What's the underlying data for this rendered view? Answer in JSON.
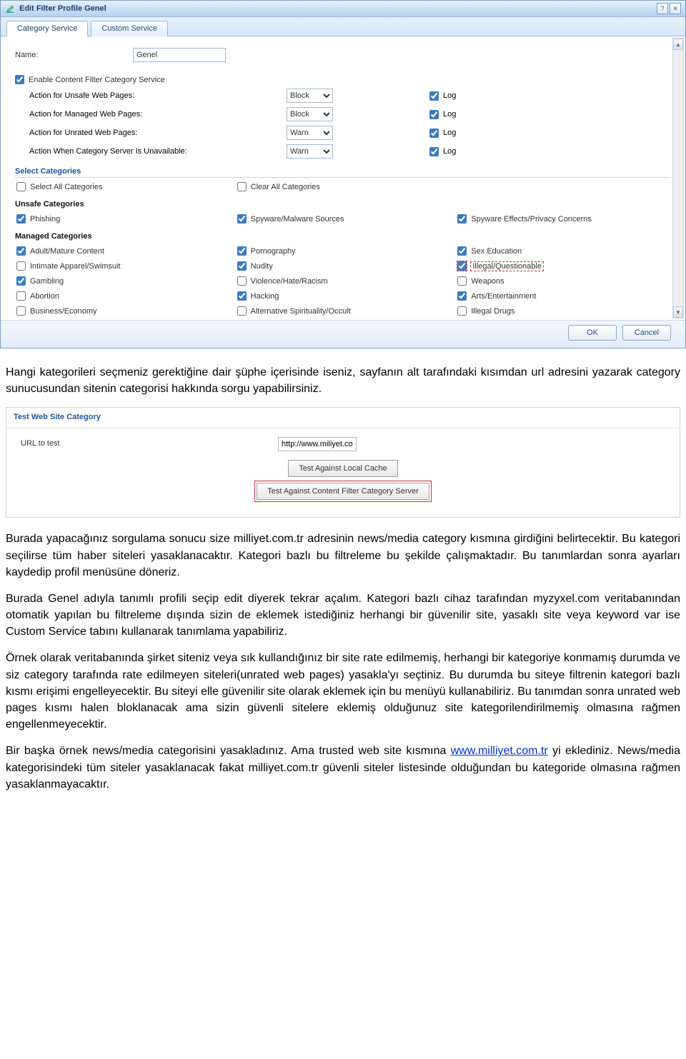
{
  "dialog": {
    "title": "Edit Filter Profile Genel",
    "tabs": {
      "category": "Category Service",
      "custom": "Custom Service"
    },
    "name_label": "Name:",
    "name_value": "Genel",
    "enable_label": "Enable Content Filter Category Service",
    "actions": {
      "unsafe": {
        "label": "Action for Unsafe Web Pages:",
        "value": "Block",
        "log": "Log"
      },
      "managed": {
        "label": "Action for Managed Web Pages:",
        "value": "Block",
        "log": "Log"
      },
      "unrated": {
        "label": "Action for Unrated Web Pages:",
        "value": "Warn",
        "log": "Log"
      },
      "unavailable": {
        "label": "Action When Category Server Is Unavailable:",
        "value": "Warn",
        "log": "Log"
      }
    },
    "select_categories_head": "Select Categories",
    "select_all": "Select All Categories",
    "clear_all": "Clear All Categories",
    "unsafe_head": "Unsafe Categories",
    "unsafe": {
      "phishing": "Phishing",
      "spyware_sources": "Spyware/Malware Sources",
      "spyware_effects": "Spyware Effects/Privacy Concerns"
    },
    "managed_head": "Managed Categories",
    "managed": {
      "adult": "Adult/Mature Content",
      "pornography": "Pornography",
      "sex_ed": "Sex Education",
      "intimate": "Intimate Apparel/Swimsuit",
      "nudity": "Nudity",
      "illegal_q": "Illegal/Questionable",
      "gambling": "Gambling",
      "violence": "Violence/Hate/Racism",
      "weapons": "Weapons",
      "abortion": "Abortion",
      "hacking": "Hacking",
      "arts": "Arts/Entertainment",
      "business": "Business/Economy",
      "alt_spirit": "Alternative Spirituality/Occult",
      "illegal_drugs": "Illegal Drugs"
    },
    "ok": "OK",
    "cancel": "Cancel"
  },
  "doc": {
    "p1": "Hangi kategorileri seçmeniz gerektiğine dair şüphe içerisinde iseniz, sayfanın alt tarafındaki kısımdan url adresini yazarak category sunucusundan sitenin categorisi hakkında sorgu yapabilirsiniz.",
    "p2": "Burada yapacağınız sorgulama sonucu size milliyet.com.tr adresinin news/media category kısmına girdiğini belirtecektir. Bu kategori seçilirse tüm haber siteleri yasaklanacaktır. Kategori bazlı bu filtreleme bu şekilde çalışmaktadır. Bu tanımlardan sonra ayarları kaydedip profil menüsüne döneriz.",
    "p3": "Burada Genel adıyla tanımlı profili seçip edit diyerek tekrar açalım. Kategori bazlı cihaz tarafından myzyxel.com veritabanından otomatik yapılan bu filtreleme dışında sizin de eklemek istediğiniz herhangi bir güvenilir site, yasaklı site veya keyword var ise Custom Service tabını kullanarak tanımlama yapabiliriz.",
    "p4": "Örnek olarak veritabanında şirket siteniz veya sık kullandığınız bir site rate edilmemiş, herhangi bir kategoriye konmamış durumda ve siz category tarafında rate edilmeyen siteleri(unrated web pages) yasakla'yı seçtiniz. Bu durumda bu siteye filtrenin kategori bazlı kısmı erişimi engelleyecektir. Bu siteyi elle güvenilir site olarak eklemek için bu menüyü kullanabiliriz. Bu tanımdan sonra unrated web pages kısmı halen bloklanacak ama sizin güvenli sitelere eklemiş olduğunuz site kategorilendirilmemiş olmasına rağmen engellenmeyecektir.",
    "p5a": "Bir başka örnek news/media categorisini yasakladınız. Ama trusted web site kısmına ",
    "p5link": "www.milliyet.com.tr",
    "p5b": " yi eklediniz. News/media kategorisindeki tüm siteler yasaklanacak fakat milliyet.com.tr güvenli siteler listesinde olduğundan bu kategoride olmasına rağmen yasaklanmayacaktır."
  },
  "test": {
    "head": "Test Web Site Category",
    "url_label": "URL to test",
    "url_value": "http://www.miliyet.co",
    "btn_local": "Test Against Local Cache",
    "btn_server": "Test Against Content Filter Category Server"
  }
}
